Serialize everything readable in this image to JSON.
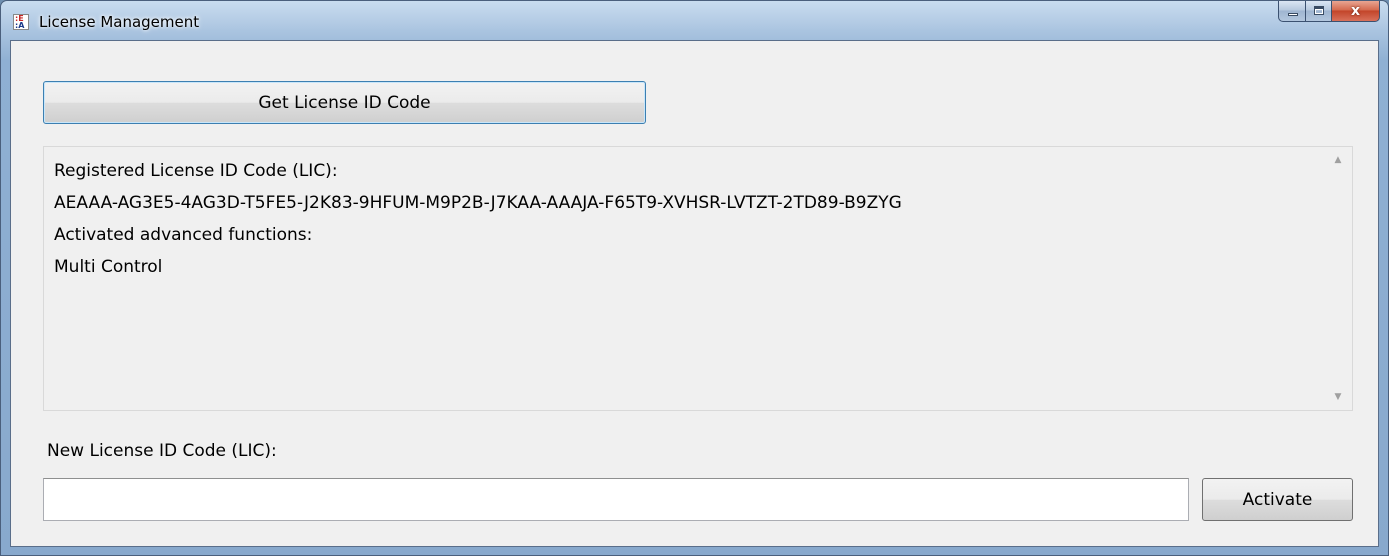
{
  "window": {
    "title": "License Management",
    "icon": "app-logo-icon",
    "controls": {
      "minimize": "minimize-icon",
      "maximize": "maximize-icon",
      "close_glyph": "x"
    }
  },
  "buttons": {
    "get_license_label": "Get License ID Code",
    "activate_label": "Activate"
  },
  "info_panel": {
    "lines": [
      "Registered License ID Code (LIC):",
      "AEAAA-AG3E5-4AG3D-T5FE5-J2K83-9HFUM-M9P2B-J7KAA-AAAJA-F65T9-XVHSR-LVTZT-2TD89-B9ZYG",
      "Activated advanced functions:",
      "Multi Control"
    ]
  },
  "new_license": {
    "label": "New License ID Code (LIC):",
    "value": "",
    "placeholder": ""
  },
  "colors": {
    "frame": "#88a9cd",
    "client_bg": "#f0f0f0",
    "focus_border": "#3c7fb1",
    "close_button": "#c3452a"
  }
}
